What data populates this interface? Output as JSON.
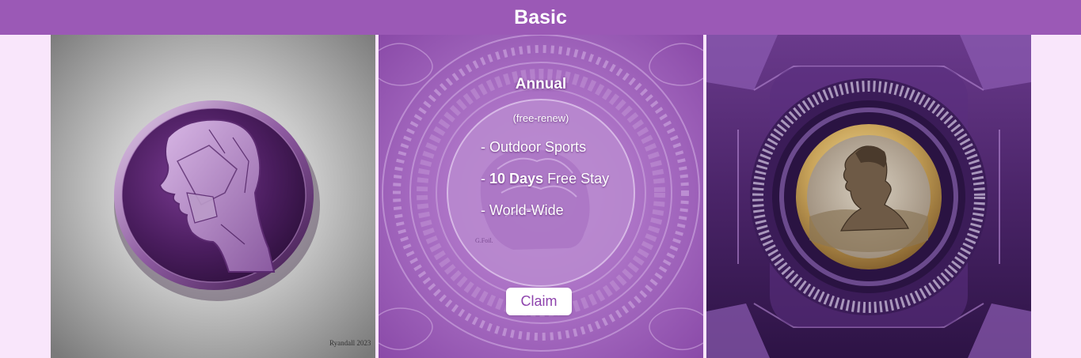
{
  "header": {
    "title": "Basic"
  },
  "plan": {
    "title": "Annual",
    "subtitle": "(free-renew)",
    "features": [
      {
        "prefix": "- ",
        "bold": "",
        "text": "Outdoor Sports"
      },
      {
        "prefix": "- ",
        "bold": "10 Days",
        "text": " Free Stay"
      },
      {
        "prefix": "- ",
        "bold": "",
        "text": "World-Wide"
      }
    ],
    "claim_label": "Claim"
  },
  "images": {
    "left": {
      "signature": "Ryandall 2023"
    },
    "middle": {
      "signature": "G.Foil."
    }
  },
  "colors": {
    "header_bg": "#9b59b6",
    "page_bg": "#f9e6fb",
    "accent": "#8e44ad",
    "button_bg": "#ffffff"
  }
}
